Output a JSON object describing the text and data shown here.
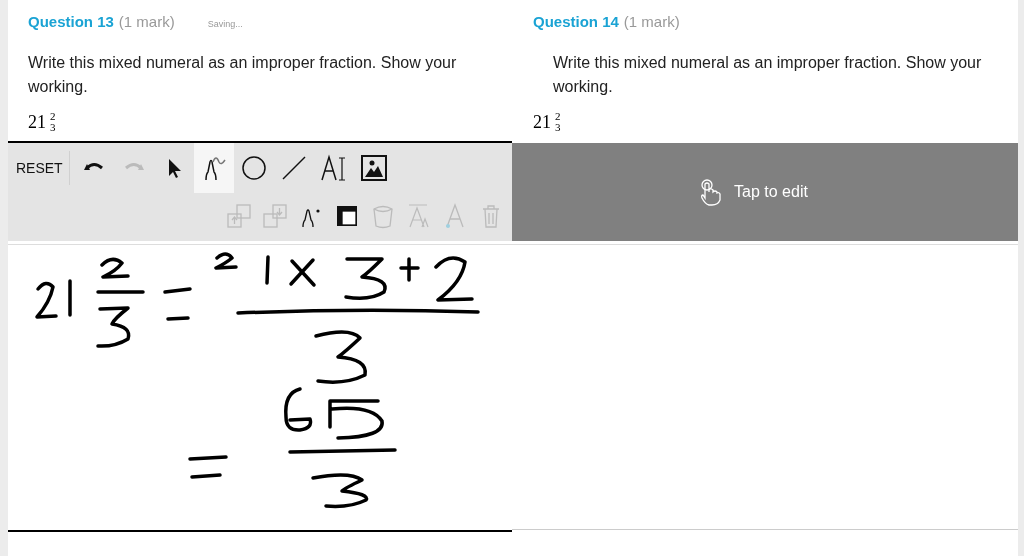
{
  "questions": [
    {
      "number": "Question 13",
      "marks": "(1 mark)",
      "status": "Saving...",
      "prompt": "Write this mixed numeral as an improper fraction. Show your working.",
      "whole": "21",
      "numerator": "2",
      "denominator": "3",
      "editor": {
        "kind": "toolbar",
        "reset": "RESET",
        "tools": [
          {
            "kind": "undo",
            "selected": false,
            "disabled": false
          },
          {
            "kind": "redo",
            "selected": false,
            "disabled": true
          },
          {
            "kind": "select",
            "selected": false,
            "disabled": false
          },
          {
            "kind": "pen",
            "selected": true,
            "disabled": false
          },
          {
            "kind": "circle",
            "selected": false,
            "disabled": false
          },
          {
            "kind": "line",
            "selected": false,
            "disabled": false
          },
          {
            "kind": "text",
            "selected": false,
            "disabled": false
          },
          {
            "kind": "image",
            "selected": false,
            "disabled": false
          }
        ],
        "options": [
          {
            "kind": "bring-forward",
            "disabled": true
          },
          {
            "kind": "send-backward",
            "disabled": true
          },
          {
            "kind": "pen-size",
            "disabled": false
          },
          {
            "kind": "stroke-color",
            "disabled": false
          },
          {
            "kind": "fill",
            "disabled": true
          },
          {
            "kind": "text-size",
            "disabled": true
          },
          {
            "kind": "text-color",
            "disabled": true
          },
          {
            "kind": "delete",
            "disabled": true
          }
        ]
      }
    },
    {
      "number": "Question 14",
      "marks": "(1 mark)",
      "prompt": "Write this mixed numeral as an improper fraction. Show your working.",
      "whole": "21",
      "numerator": "2",
      "denominator": "3",
      "editor": {
        "kind": "locked",
        "label": "Tap to edit"
      }
    }
  ]
}
